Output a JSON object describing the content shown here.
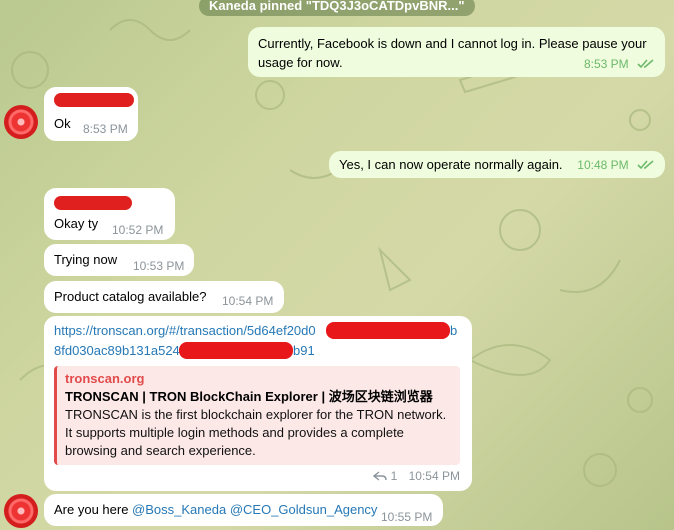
{
  "pinned": {
    "text": "Kaneda pinned \"TDQ3J3oCATDpvBNR...\""
  },
  "messages": [
    {
      "id": "m1",
      "text": "Currently, Facebook is down and I cannot log in. Please pause your usage for now.",
      "time": "8:53 PM"
    },
    {
      "id": "m2",
      "text": "Ok",
      "time": "8:53 PM"
    },
    {
      "id": "m3",
      "text": "Yes, I can now operate normally again.",
      "time": "10:48 PM"
    },
    {
      "id": "m4",
      "text": "Okay ty",
      "time": "10:52 PM"
    },
    {
      "id": "m5",
      "text": "Trying now",
      "time": "10:53 PM"
    },
    {
      "id": "m6",
      "text": "Product catalog available?",
      "time": "10:54 PM"
    },
    {
      "id": "m7",
      "link_line1": "https://tronscan.org/#/transaction/5d64ef20d0",
      "link_line1_tail": "b",
      "link_line2": "8fd030ac89b131a524",
      "link_line2_tail": "b91",
      "preview_site": "tronscan.org",
      "preview_title": "TRONSCAN | TRON BlockChain Explorer | 波场区块链浏览器",
      "preview_desc": "TRONSCAN is the first blockchain explorer for the TRON network. It supports multiple login methods and provides a complete browsing and search experience.",
      "replies": "1",
      "time": "10:54 PM"
    },
    {
      "id": "m8",
      "text_prefix": "Are you here ",
      "mention1": "@Boss_Kaneda",
      "mention2": "@CEO_Goldsun_Agency",
      "time": "10:55 PM"
    }
  ],
  "colors": {
    "outgoing": "#effdde",
    "incoming": "#ffffff",
    "link": "#2678b6",
    "preview_accent": "#e24b4b",
    "read_checks": "#6db86a"
  }
}
